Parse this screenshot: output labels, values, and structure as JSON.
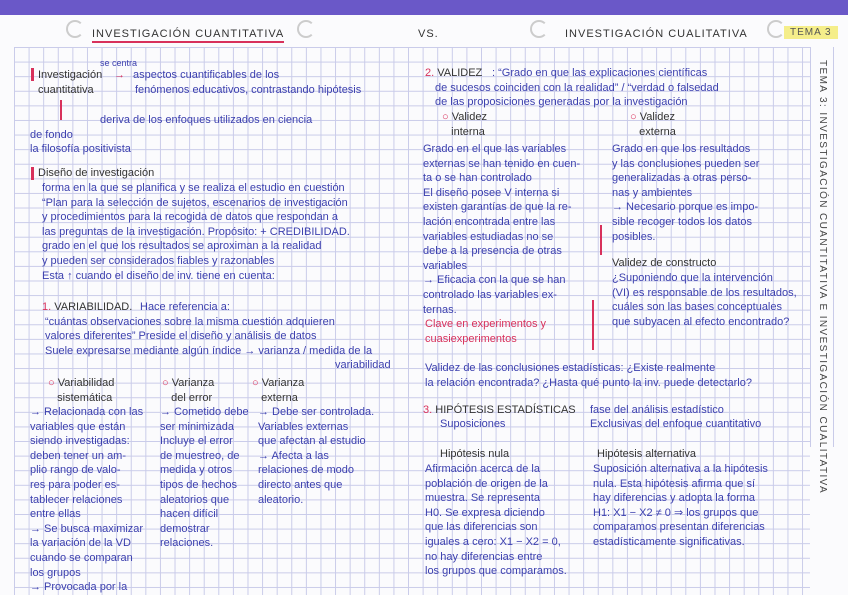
{
  "header": {
    "left_title": "INVESTIGACIÓN CUANTITATIVA",
    "vs": "VS.",
    "right_title": "INVESTIGACIÓN CUALITATIVA",
    "tema": "TEMA 3",
    "side_title": "TEMA 3: INVESTIGACIÓN CUANTITATIVA E INVESTIGACIÓN CUALITATIVA"
  },
  "intro": {
    "se_centra": "se centra",
    "term1": "Investigación",
    "term2": "cuantitativa",
    "arrow": "→",
    "def1": "aspectos cuantificables de los",
    "def2": "fenómenos educativos, contrastando hipótesis",
    "deriva": "deriva de los enfoques utilizados en ciencia",
    "fondo1": "de fondo",
    "fondo2": "la filosofía positivista"
  },
  "diseno": {
    "title": "Diseño de investigación",
    "lines": [
      "forma en la que se planifica y se realiza el estudio en cuestión",
      "“Plan para la selección de sujetos, escenarios de investigación",
      "y procedimientos para la recogida de datos que respondan a",
      "las preguntas de la investigación. Propósito: + CREDIBILIDAD.",
      "grado en el que los resultados se aproximan a la realidad",
      "y pueden ser considerados fiables y razonables",
      "Esta ↑ cuando el diseño de inv. tiene en cuenta:"
    ]
  },
  "variabilidad": {
    "num": "1.",
    "title": "VARIABILIDAD.",
    "lines": [
      "Hace referencia a:",
      "“cuántas observaciones sobre la misma cuestión adquieren",
      "valores diferentes” Preside el diseño y análisis de datos",
      "Suele expresarse mediante algún índice → varianza / medida de la",
      "variabilidad"
    ],
    "cols": [
      {
        "title": [
          "Variabilidad",
          "sistemática"
        ],
        "lines": [
          "→ Relacionada con las",
          "variables que están",
          "siendo investigadas:",
          "deben tener un am-",
          "plio rango de valo-",
          "res para poder es-",
          "tablecer relaciones",
          "entre ellas",
          "→ Se busca maximizar",
          "la variación de la VD",
          "cuando se comparan",
          "los grupos",
          "→ Provocada por la"
        ]
      },
      {
        "title": [
          "Varianza",
          "del error"
        ],
        "lines": [
          "→ Cometido debe",
          "ser minimizada",
          "Incluye el error",
          "de muestreo, de",
          "medida y otros",
          "tipos de hechos",
          "aleatorios que",
          "hacen difícil",
          "demostrar",
          "relaciones."
        ]
      },
      {
        "title": [
          "Varianza",
          "externa"
        ],
        "lines": [
          "→ Debe ser controlada.",
          "Variables externas",
          "que afectan al estudio",
          "→ Afecta a las",
          "relaciones de modo",
          "directo antes que",
          "aleatorio."
        ]
      }
    ]
  },
  "validez": {
    "num": "2.",
    "title": "VALIDEZ",
    "lines": [
      ": “Grado en que las explicaciones científicas",
      "de sucesos coinciden con la realidad” / “verdad o falsedad",
      "de las proposiciones generadas por la investigación"
    ],
    "interna": {
      "title": [
        "Validez",
        "interna"
      ],
      "lines": [
        "Grado en el que las variables",
        "externas se han tenido en cuen-",
        "ta o se han controlado",
        "El diseño posee V interna si",
        "existen garantías de que la re-",
        "lación encontrada entre las",
        "variables estudiadas no se",
        "debe a la presencia de otras",
        "variables",
        "→ Eficacia con la que se han",
        "controlado las variables ex-",
        "ternas."
      ],
      "note": [
        "Clave en experimentos y",
        "cuasiexperimentos"
      ]
    },
    "externa": {
      "title": [
        "Validez",
        "externa"
      ],
      "lines": [
        "Grado en que los resultados",
        "y las conclusiones pueden ser",
        "generalizadas a otras perso-",
        "nas y ambientes",
        "→ Necesario porque es impo-",
        "sible recoger todos los datos",
        "posibles."
      ]
    },
    "constructo": {
      "title": "Validez de constructo",
      "lines": [
        "¿Suponiendo que la intervención",
        "(VI) es responsable de los resultados,",
        "cuáles son las bases conceptuales",
        "que subyacen al efecto encontrado?"
      ]
    },
    "conclusiones": {
      "lines": [
        "Validez de las conclusiones estadísticas: ¿Existe realmente",
        "la relación encontrada? ¿Hasta qué punto la inv. puede detectarlo?"
      ]
    }
  },
  "hipotesis": {
    "num": "3.",
    "title": "HIPÓTESIS ESTADÍSTICAS",
    "fase": "fase del análisis estadístico",
    "suposiciones": "Suposiciones",
    "exclusivas": "Exclusivas del enfoque cuantitativo",
    "nula": {
      "title": "Hipótesis nula",
      "lines": [
        "Afirmación acerca de la",
        "población de origen de la",
        "muestra. Se representa",
        "H0. Se expresa diciendo",
        "que las diferencias son",
        "iguales a cero: X1 − X2 = 0,",
        "no hay diferencias entre",
        "los grupos que comparamos."
      ]
    },
    "alternativa": {
      "title": "Hipótesis alternativa",
      "lines": [
        "Suposición alternativa a la hipótesis",
        "nula. Esta hipótesis afirma que sí",
        "hay diferencias y adopta la forma",
        "H1: X1 − X2 ≠ 0 ⇒ los grupos que",
        "comparamos presentan diferencias",
        "estadísticamente significativas."
      ]
    }
  },
  "colors": {
    "ink": "#3b3fae",
    "accent": "#d8315b",
    "band": "#6a58c8",
    "highlight": "#f5ee8a"
  }
}
